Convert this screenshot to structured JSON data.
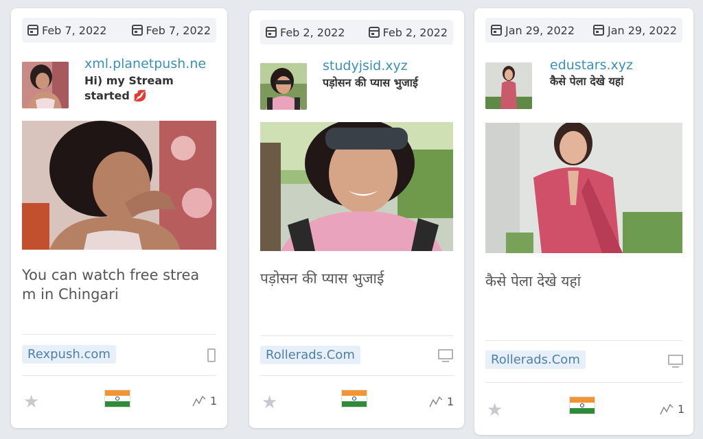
{
  "cards": [
    {
      "first_seen": "Feb 7, 2022",
      "last_seen": "Feb 7, 2022",
      "domain": "xml.planetpush.ne",
      "heading_line1": "Hi) my Stream",
      "heading_line2": "started",
      "heading_emoji": "💋",
      "description": "You can watch free strea m in Chingari",
      "network": "Rexpush.com",
      "device": "mobile",
      "country": "India",
      "count": "1"
    },
    {
      "first_seen": "Feb 2, 2022",
      "last_seen": "Feb 2, 2022",
      "domain": "studyjsid.xyz",
      "heading_line1": "पड़ोसन की प्यास भुजाई",
      "description": "पड़ोसन की प्यास भुजाई",
      "network": "Rollerads.Com",
      "device": "desktop",
      "country": "India",
      "count": "1"
    },
    {
      "first_seen": "Jan 29, 2022",
      "last_seen": "Jan 29, 2022",
      "domain": "edustars.xyz",
      "heading_line1": "कैसे पेला देखे यहां",
      "description": "कैसे पेला देखे यहां",
      "network": "Rollerads.Com",
      "device": "desktop",
      "country": "India",
      "count": "1"
    }
  ]
}
